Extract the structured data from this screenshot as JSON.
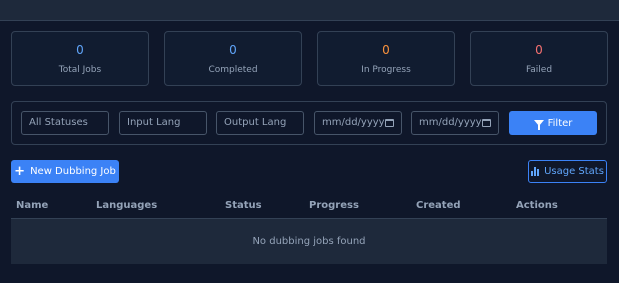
{
  "stats": [
    {
      "value": "0",
      "label": "Total Jobs",
      "color": "#60a5fa"
    },
    {
      "value": "0",
      "label": "Completed",
      "color": "#60a5fa"
    },
    {
      "value": "0",
      "label": "In Progress",
      "color": "#fb923c"
    },
    {
      "value": "0",
      "label": "Failed",
      "color": "#f87171"
    }
  ],
  "filters": {
    "status_selected": "All Statuses",
    "input_lang_placeholder": "Input Lang",
    "output_lang_placeholder": "Output Lang",
    "date_from_placeholder": "mm/dd/yyyy",
    "date_to_placeholder": "mm/dd/yyyy",
    "filter_label": "Filter"
  },
  "actions": {
    "new_job_label": "New Dubbing Job",
    "usage_stats_label": "Usage Stats"
  },
  "table": {
    "columns": [
      "Name",
      "Languages",
      "Status",
      "Progress",
      "Created",
      "Actions"
    ],
    "empty_message": "No dubbing jobs found"
  },
  "colors": {
    "accent": "#3b82f6",
    "background": "#0f172a"
  }
}
